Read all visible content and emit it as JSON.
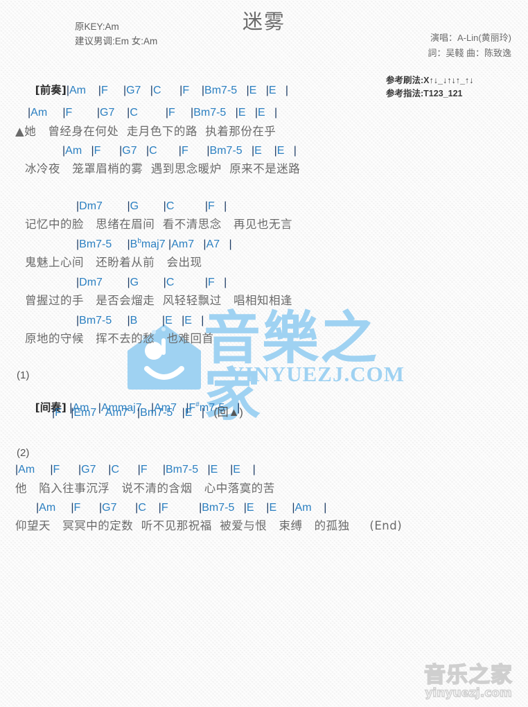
{
  "page": {
    "title": "迷雾",
    "accent_chord_color": "#2a7fc1",
    "bar_color": "#1b3a63",
    "lyric_color": "#6a6a6a",
    "watermark_color": "#9fd2f2",
    "background_color": "#f4f4f4"
  },
  "meta": {
    "original_key": "原KEY:Am",
    "suggested_key": "建议男调:Em 女:Am",
    "singer": "演唱：A-Lin(黄丽玲)",
    "credits": "詞：吴輚  曲：陈致逸",
    "strum_label": "参考刷法:",
    "strum_pattern": "X↑↓_↓↑↓↑_↑↓",
    "fingerstyle_label": "参考指法:",
    "fingerstyle_pattern": "T123_121"
  },
  "watermarks": {
    "main_cn": "音樂之家",
    "main_url": "YINYUEZJ.COM",
    "bottom_cn": "音乐之家",
    "bottom_url": "yinyuezj.com"
  },
  "sections": {
    "intro_tag": "[前奏]",
    "interlude_tag": "[间奏]",
    "marker_1": "(1)",
    "marker_2": "(2)",
    "repeat_note": "(回▲)",
    "end_note": "(End)"
  },
  "lines": {
    "intro_chords": "|Am    |F     |G7   |C      |F    |Bm7-5   |E   |E   |",
    "v1_c1": "|Am     |F        |G7    |C         |F     |Bm7-5   |E   |E   |",
    "v1_l1": "▲她   曾经身在何处  走月色下的路  执着那份在乎",
    "v1_c2": "|Am   |F      |G7   |C       |F      |Bm7-5   |E    |E   |",
    "v1_l2": "冰冷夜   笼罩眉梢的雾  遇到思念暖炉  原来不是迷路",
    "v2_c1": "|Dm7        |G        |C          |F   |",
    "v2_l1": "记忆中的脸   思绪在眉间  看不清思念   再见也无言",
    "v2_c2": "|Bm7-5     |B♭maj7 |Am7   |A7   |",
    "v2_l2": "鬼魅上心间   还盼着从前   会出现",
    "v3_c1": "|Dm7        |G        |C          |F   |",
    "v3_l1": "曾握过的手   是否会熘走  风轻轻飘过   唱相知相逢",
    "v3_c2": "|Bm7-5     |B        |E   |E   |",
    "v3_l2": "原地的守候   挥不去的愁   也难回首",
    "inter_c1": "|Am   |Ammaj7   |Am7   |F♯m7-5    |",
    "inter_c2": "|F   |Em7   Am7   |Bm7-5   |E   |   (回▲)",
    "v4_c1": "|Am     |F      |G7    |C      |F     |Bm7-5   |E    |E    |",
    "v4_l1": "他   陷入往事沉浮   说不清的含烟   心中落寞的苦",
    "v4_c2": "|Am     |F      |G7      |C    |F          |Bm7-5   |E    |E     |Am    |",
    "v4_l2": "仰望天   冥冥中的定数  听不见那祝福  被爱与恨   束缚   的孤独     (End)"
  },
  "chord_tokens": {
    "intro": [
      "Am",
      "F",
      "G7",
      "C",
      "F",
      "Bm7-5",
      "E",
      "E"
    ],
    "verse1a": [
      "Am",
      "F",
      "G7",
      "C",
      "F",
      "Bm7-5",
      "E",
      "E"
    ],
    "verse1b": [
      "Am",
      "F",
      "G7",
      "C",
      "F",
      "Bm7-5",
      "E",
      "E"
    ],
    "verse2a": [
      "Dm7",
      "G",
      "C",
      "F"
    ],
    "verse2b": [
      "Bm7-5",
      "Bbmaj7",
      "Am7",
      "A7"
    ],
    "verse3a": [
      "Dm7",
      "G",
      "C",
      "F"
    ],
    "verse3b": [
      "Bm7-5",
      "B",
      "E",
      "E"
    ],
    "interlude1": [
      "Am",
      "Ammaj7",
      "Am7",
      "F#m7-5"
    ],
    "interlude2": [
      "F",
      "Em7",
      "Am7",
      "Bm7-5",
      "E"
    ],
    "verse4a": [
      "Am",
      "F",
      "G7",
      "C",
      "F",
      "Bm7-5",
      "E",
      "E"
    ],
    "verse4b": [
      "Am",
      "F",
      "G7",
      "C",
      "F",
      "Bm7-5",
      "E",
      "E",
      "Am"
    ]
  }
}
